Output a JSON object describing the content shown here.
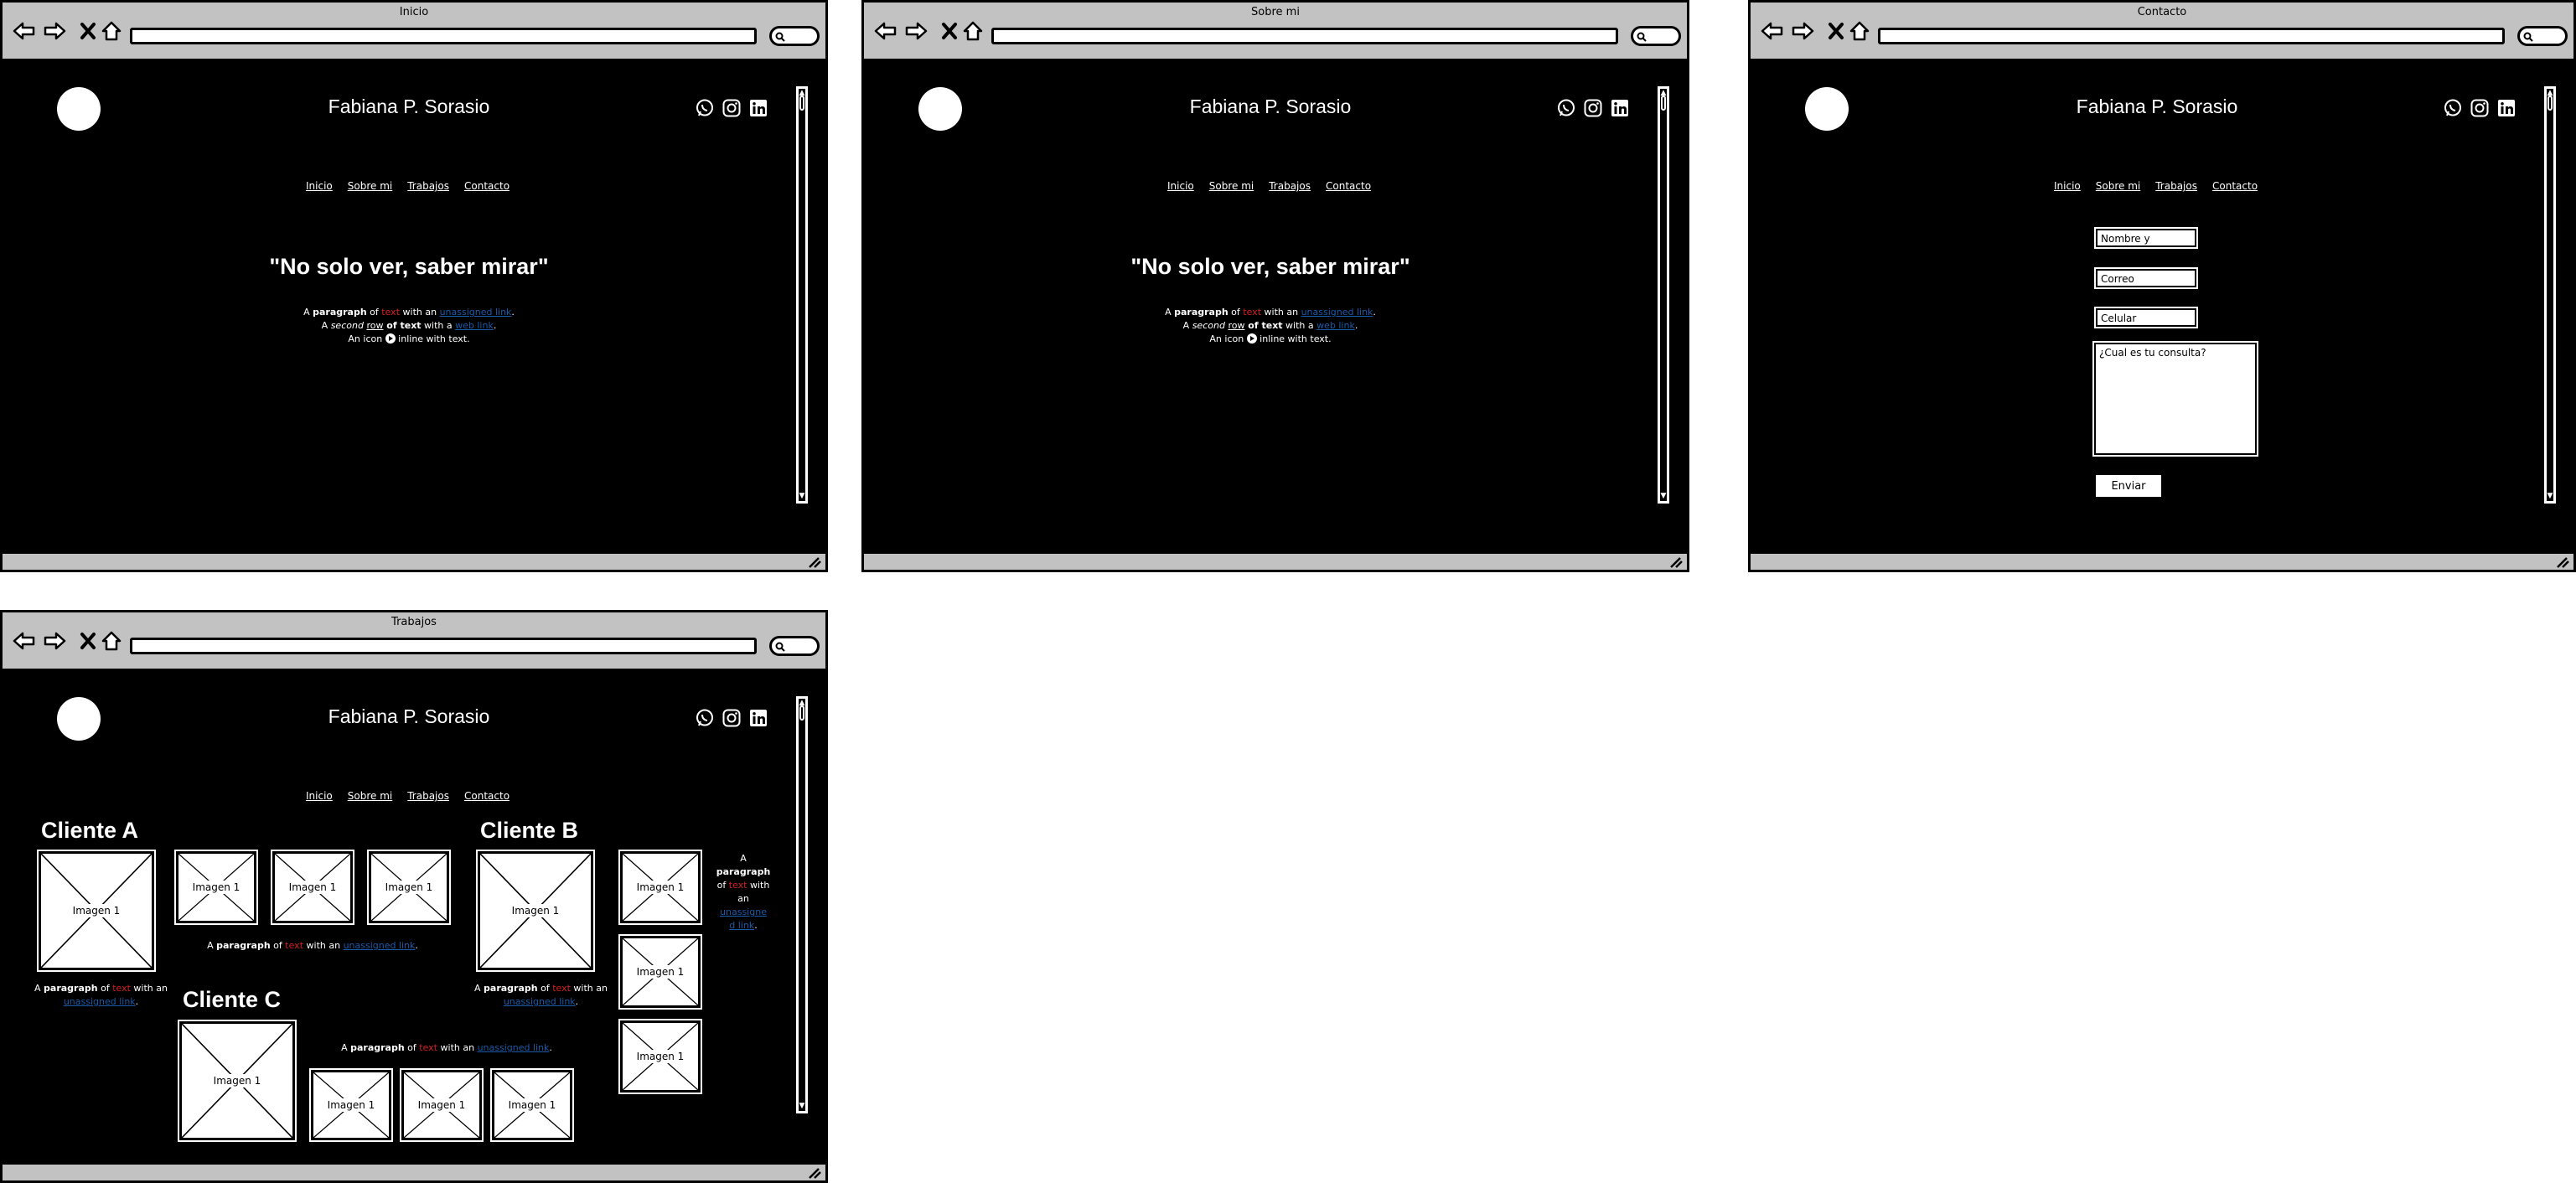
{
  "site": {
    "name": "Fabiana P. Sorasio",
    "menu": [
      "Inicio",
      "Sobre mi",
      "Trabajos",
      "Contacto"
    ],
    "social_icons": [
      "whatsapp-icon",
      "instagram-icon",
      "linkedin-icon"
    ]
  },
  "browser_icons": [
    "back-arrow-icon",
    "forward-arrow-icon",
    "close-icon",
    "home-icon",
    "search-icon",
    "resize-grip-icon"
  ],
  "windows": {
    "inicio": {
      "title": "Inicio"
    },
    "sobre": {
      "title": "Sobre mi"
    },
    "contacto": {
      "title": "Contacto"
    },
    "trabajos": {
      "title": "Trabajos"
    }
  },
  "hero": {
    "headline": "\"No solo ver, saber mirar\"",
    "line1": {
      "a": "A ",
      "b": "paragraph",
      "c": " of ",
      "d": "text",
      "e": " with an ",
      "f": "unassigned link",
      "g": "."
    },
    "line2": {
      "a": "A ",
      "b": "second",
      "c": " ",
      "d": "row",
      "e": " of ",
      "f": "text",
      "g": " with a ",
      "h": "web link",
      "i": "."
    },
    "line3": {
      "a": "An icon ",
      "b": " inline with text."
    }
  },
  "contact_form": {
    "name": "Nombre y Apellido",
    "email": "Correo electronico",
    "phone": "Celular",
    "question": "¿Cual es tu consulta?",
    "submit": "Enviar"
  },
  "works": {
    "client_a": "Cliente A",
    "client_b": "Cliente B",
    "client_c": "Cliente C",
    "image_label": "Imagen 1",
    "para": {
      "a": "A ",
      "b": "paragraph",
      "c": " of ",
      "d": "text",
      "e": " with an ",
      "f": "unassigned link",
      "g": "."
    },
    "narrow_para": {
      "a": "A",
      "b": "paragraph",
      "c": "of ",
      "d": "text",
      "e": " with",
      "f": "an",
      "g": "unassigne",
      "h": "d link",
      "i": "."
    }
  },
  "colors": {
    "chrome": "#c2c2c2",
    "canvas": "#000000",
    "accent_red": "#d52020",
    "link_blue": "#1a5aa8"
  }
}
